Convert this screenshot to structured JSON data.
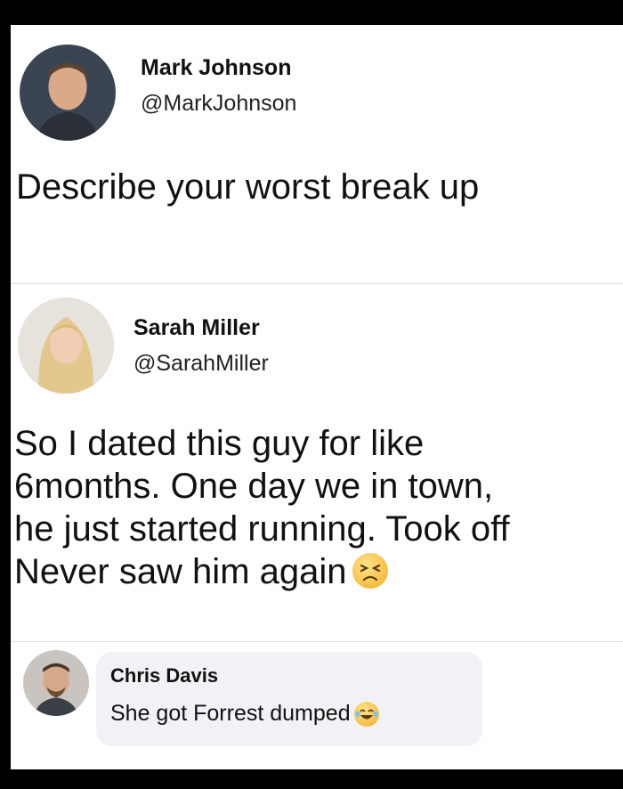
{
  "posts": [
    {
      "name": "Mark Johnson",
      "handle": "@MarkJohnson",
      "text": "Describe your worst break up"
    },
    {
      "name": "Sarah Miller",
      "handle": "@SarahMiller",
      "text": "So I dated this guy for like\n6months. One day we in town,\nhe just started running. Took off\nNever saw him again"
    }
  ],
  "comment": {
    "name": "Chris Davis",
    "text": "She got Forrest dumped"
  },
  "icons": {
    "post2_emoji": "persevering-face-emoji",
    "comment_emoji": "tears-of-joy-emoji"
  },
  "colors": {
    "frame": "#000000",
    "card": "#ffffff",
    "comment_bubble": "#f0f2f5"
  }
}
